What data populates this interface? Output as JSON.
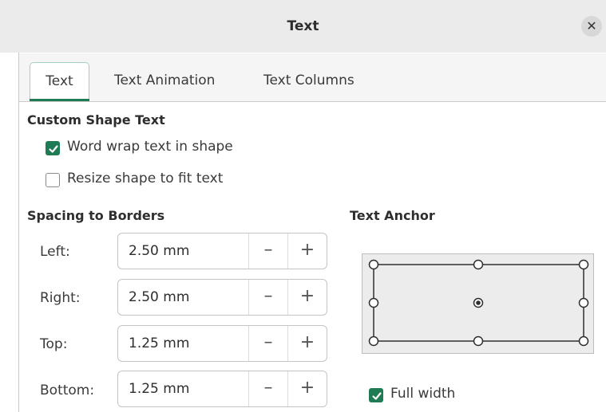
{
  "window": {
    "title": "Text",
    "close_icon": "close-icon"
  },
  "tabs": [
    {
      "label": "Text",
      "active": true
    },
    {
      "label": "Text Animation",
      "active": false
    },
    {
      "label": "Text Columns",
      "active": false
    }
  ],
  "custom_shape_text": {
    "title": "Custom Shape Text",
    "word_wrap": {
      "label": "Word wrap text in shape",
      "checked": true
    },
    "resize_shape": {
      "label": "Resize shape to fit text",
      "checked": false
    }
  },
  "spacing": {
    "title": "Spacing to Borders",
    "fields": [
      {
        "label": "Left:",
        "value": "2.50 mm"
      },
      {
        "label": "Right:",
        "value": "2.50 mm"
      },
      {
        "label": "Top:",
        "value": "1.25 mm"
      },
      {
        "label": "Bottom:",
        "value": "1.25 mm"
      }
    ],
    "minus": "–",
    "plus": "+"
  },
  "text_anchor": {
    "title": "Text Anchor",
    "selected": "center",
    "full_width": {
      "label": "Full width",
      "checked": true
    }
  },
  "colors": {
    "accent": "#1f7b54",
    "tab_border": "#a3cfc0"
  }
}
